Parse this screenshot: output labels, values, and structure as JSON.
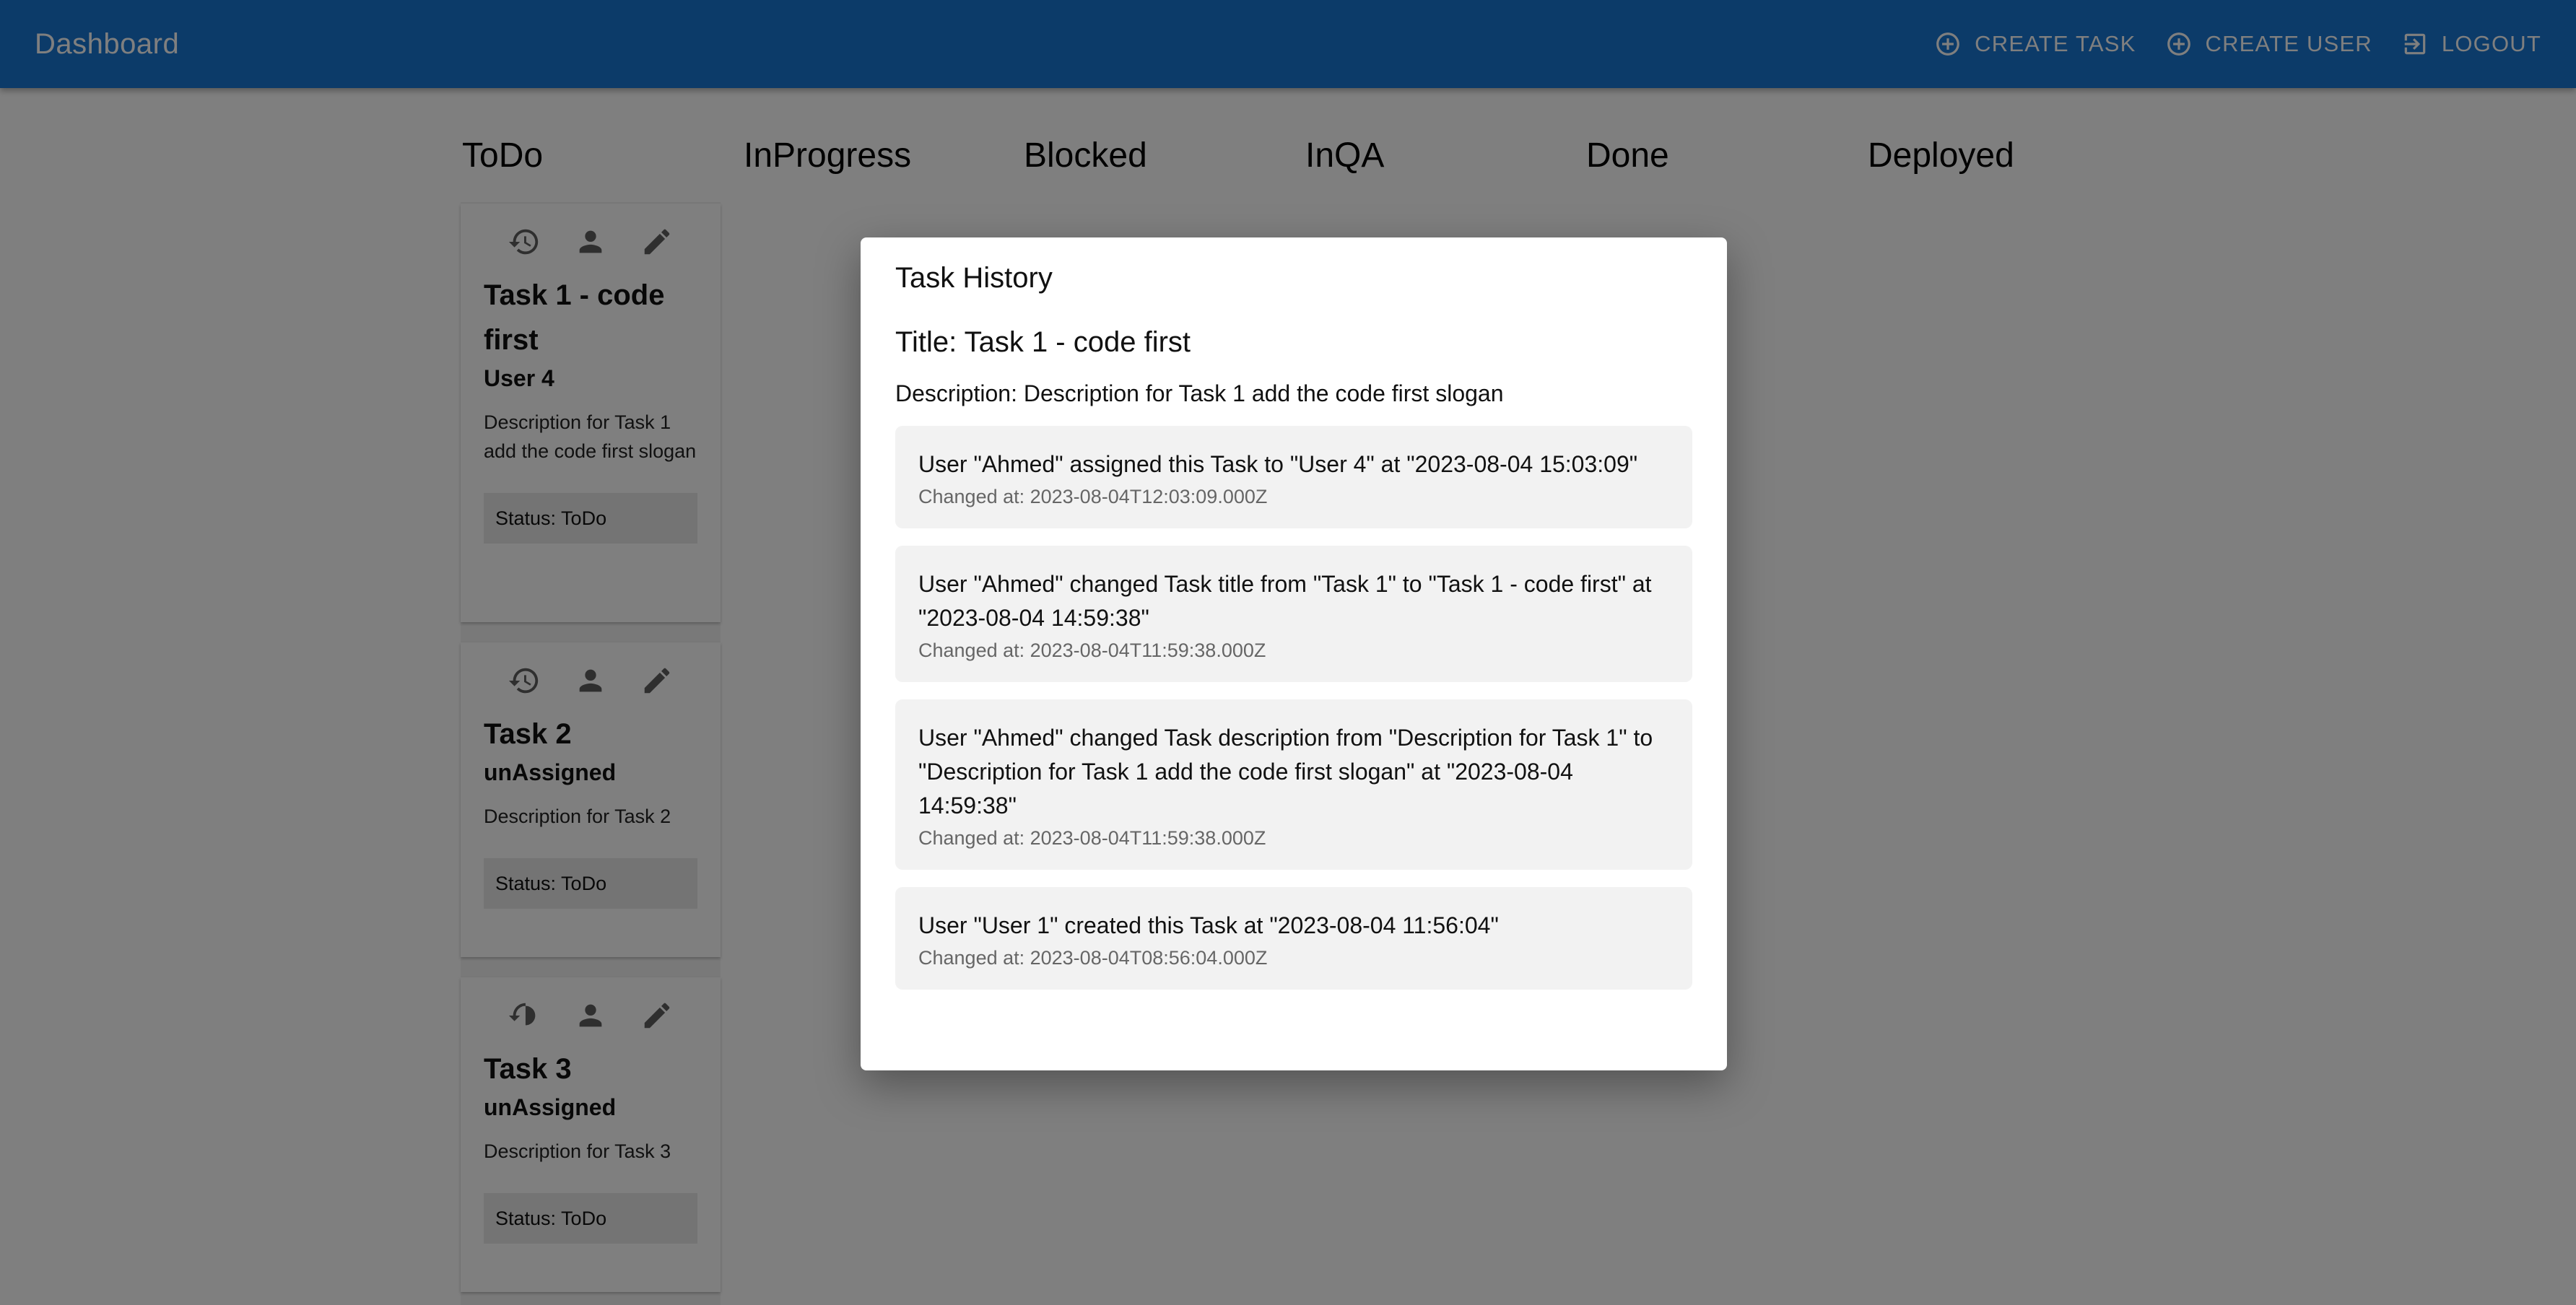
{
  "appbar": {
    "title": "Dashboard",
    "actions": [
      {
        "label": "CREATE TASK",
        "icon": "add-circle-outline-icon"
      },
      {
        "label": "CREATE USER",
        "icon": "add-circle-outline-icon"
      },
      {
        "label": "LOGOUT",
        "icon": "logout-icon"
      }
    ]
  },
  "board": {
    "columns": [
      "ToDo",
      "InProgress",
      "Blocked",
      "InQA",
      "Done",
      "Deployed"
    ],
    "cards": [
      {
        "title": "Task 1 - code first",
        "assignee": "User 4",
        "description": "Description for Task 1 add the code first slogan",
        "status": "Status: ToDo",
        "icons": [
          "history-icon",
          "person-icon",
          "edit-icon"
        ]
      },
      {
        "title": "Task 2",
        "assignee": "unAssigned",
        "description": "Description for Task 2",
        "status": "Status: ToDo",
        "icons": [
          "history-icon",
          "person-icon",
          "edit-icon"
        ]
      },
      {
        "title": "Task 3",
        "assignee": "unAssigned",
        "description": "Description for Task 3",
        "status": "Status: ToDo",
        "icons": [
          "history-icon",
          "person-icon",
          "edit-icon"
        ]
      }
    ]
  },
  "modal": {
    "heading": "Task History",
    "title": "Title: Task 1 - code first",
    "description": "Description: Description for Task 1 add the code first slogan",
    "history": [
      {
        "text": "User \"Ahmed\" assigned this Task to \"User 4\" at \"2023-08-04 15:03:09\"",
        "changed_at": "Changed at: 2023-08-04T12:03:09.000Z"
      },
      {
        "text": "User \"Ahmed\" changed Task title from \"Task 1\" to \"Task 1 - code first\" at \"2023-08-04 14:59:38\"",
        "changed_at": "Changed at: 2023-08-04T11:59:38.000Z"
      },
      {
        "text": "User \"Ahmed\" changed Task description from \"Description for Task 1\" to \"Description for Task 1 add the code first slogan\" at \"2023-08-04 14:59:38\"",
        "changed_at": "Changed at: 2023-08-04T11:59:38.000Z"
      },
      {
        "text": "User \"User 1\" created this Task at \"2023-08-04 11:56:04\"",
        "changed_at": "Changed at: 2023-08-04T08:56:04.000Z"
      }
    ]
  },
  "colors": {
    "appbar": "#1976d2",
    "overlay": "rgba(0,0,0,0.5)",
    "history_item_bg": "#f2f2f2"
  }
}
